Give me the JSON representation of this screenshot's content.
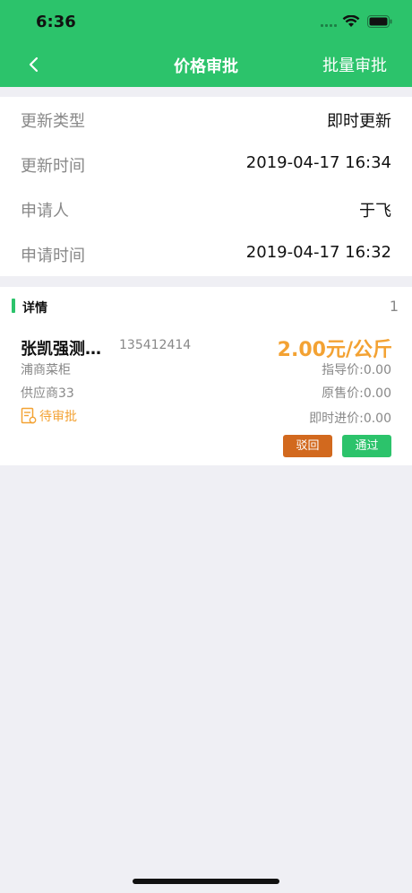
{
  "status_bar": {
    "time": "6:36"
  },
  "nav": {
    "title": "价格审批",
    "batch_label": "批量审批"
  },
  "info": [
    {
      "label": "更新类型",
      "value": "即时更新"
    },
    {
      "label": "更新时间",
      "value": "2019-04-17 16:34"
    },
    {
      "label": "申请人",
      "value": "于飞"
    },
    {
      "label": "申请时间",
      "value": "2019-04-17 16:32"
    }
  ],
  "detail": {
    "title": "详情",
    "count": "1",
    "item": {
      "name": "张凯强测…",
      "code": "135412414",
      "price": "2.00元/公斤",
      "store": "浦商菜柜",
      "guide_price": "指导价:0.00",
      "supplier": "供应商33",
      "original_price": "原售价:0.00",
      "status": "待审批",
      "instant_price": "即时进价:0.00",
      "reject_label": "驳回",
      "approve_label": "通过"
    }
  },
  "colors": {
    "brand_green": "#2cc36b",
    "price_orange": "#f3a233",
    "reject_orange": "#d2691e"
  }
}
